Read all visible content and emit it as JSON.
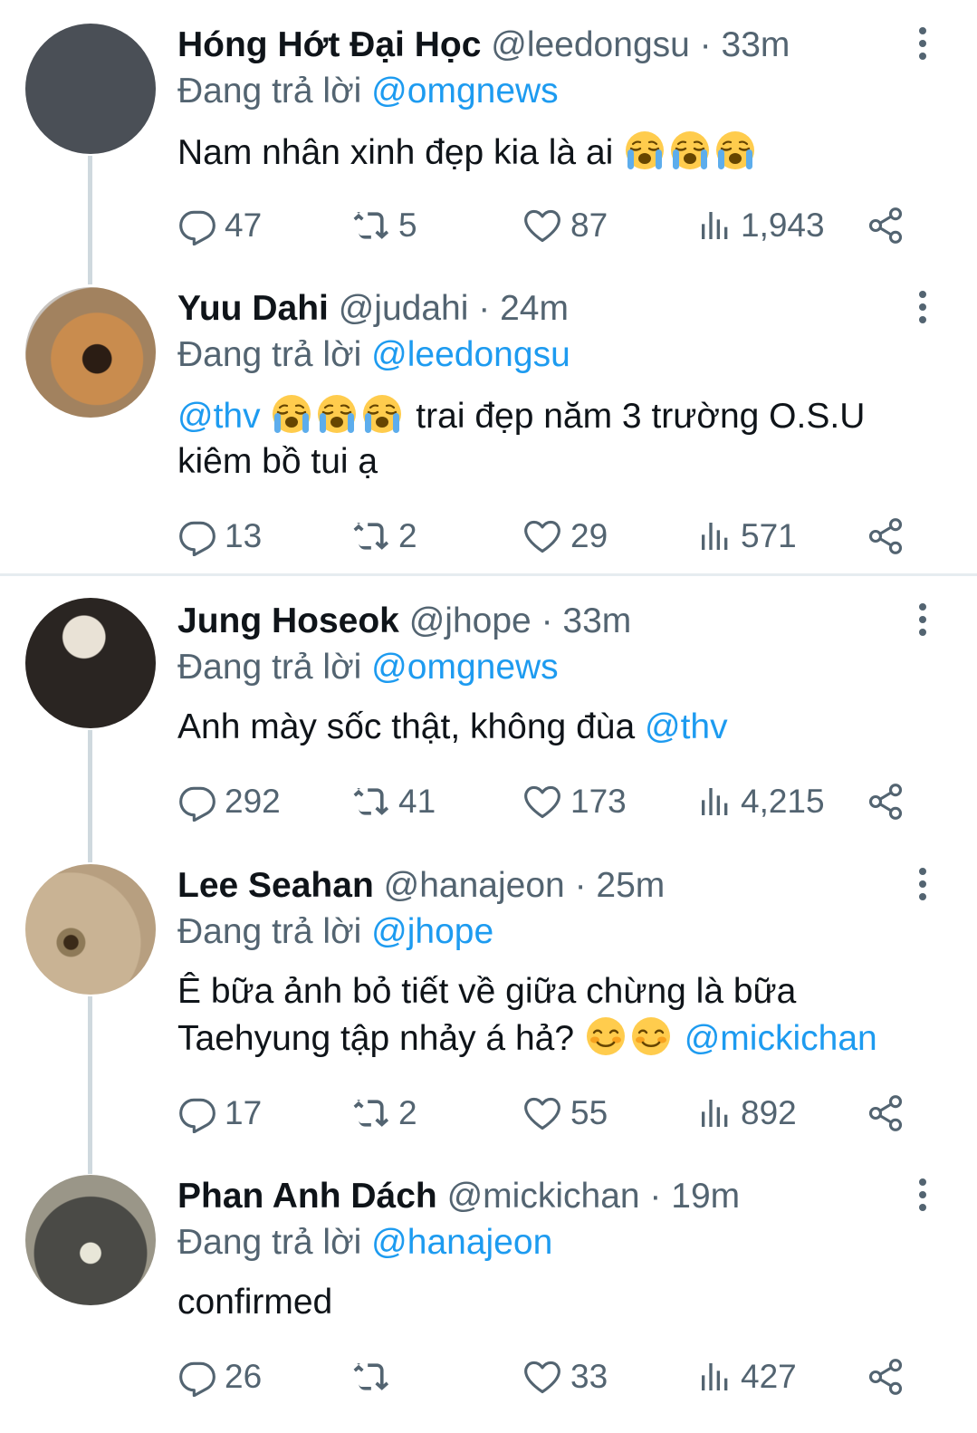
{
  "common": {
    "replying_prefix": "Đang trả lời",
    "separator": "·"
  },
  "tweets": [
    {
      "name": "Hóng Hớt Đại Học",
      "handle": "@leedongsu",
      "time": "33m",
      "replying_to": "@omgnews",
      "text": "Nam nhân xinh đẹp kia là ai",
      "emojis": [
        "loudly-crying-face",
        "loudly-crying-face",
        "loudly-crying-face"
      ],
      "stats": {
        "replies": "47",
        "retweets": "5",
        "likes": "87",
        "views": "1,943"
      }
    },
    {
      "name": "Yuu Dahi",
      "handle": "@judahi",
      "time": "24m",
      "replying_to": "@leedongsu",
      "mention": "@thv",
      "emojis": [
        "loudly-crying-face",
        "loudly-crying-face",
        "loudly-crying-face"
      ],
      "text_after": " trai đẹp năm 3 trường O.S.U kiêm bồ tui ạ",
      "stats": {
        "replies": "13",
        "retweets": "2",
        "likes": "29",
        "views": "571"
      }
    },
    {
      "name": "Jung Hoseok",
      "handle": "@jhope",
      "time": "33m",
      "replying_to": "@omgnews",
      "text": "Anh mày sốc thật, không đùa ",
      "mention": "@thv",
      "stats": {
        "replies": "292",
        "retweets": "41",
        "likes": "173",
        "views": "4,215"
      }
    },
    {
      "name": "Lee Seahan",
      "handle": "@hanajeon",
      "time": "25m",
      "replying_to": "@jhope",
      "text": "Ê bữa ảnh bỏ tiết về giữa chừng là bữa Taehyung tập nhảy á hả?",
      "emojis": [
        "smiling-face",
        "smiling-face"
      ],
      "mention": "@mickichan",
      "stats": {
        "replies": "17",
        "retweets": "2",
        "likes": "55",
        "views": "892"
      }
    },
    {
      "name": "Phan Anh Dách",
      "handle": "@mickichan",
      "time": "19m",
      "replying_to": "@hanajeon",
      "text": "confirmed",
      "stats": {
        "replies": "26",
        "retweets": "",
        "likes": "33",
        "views": "427"
      }
    }
  ],
  "colors": {
    "accent": "#1d9bf0",
    "muted": "#536471",
    "text": "#0f1419",
    "thread_line": "#cfd9de",
    "divider": "#e6ecf0"
  }
}
